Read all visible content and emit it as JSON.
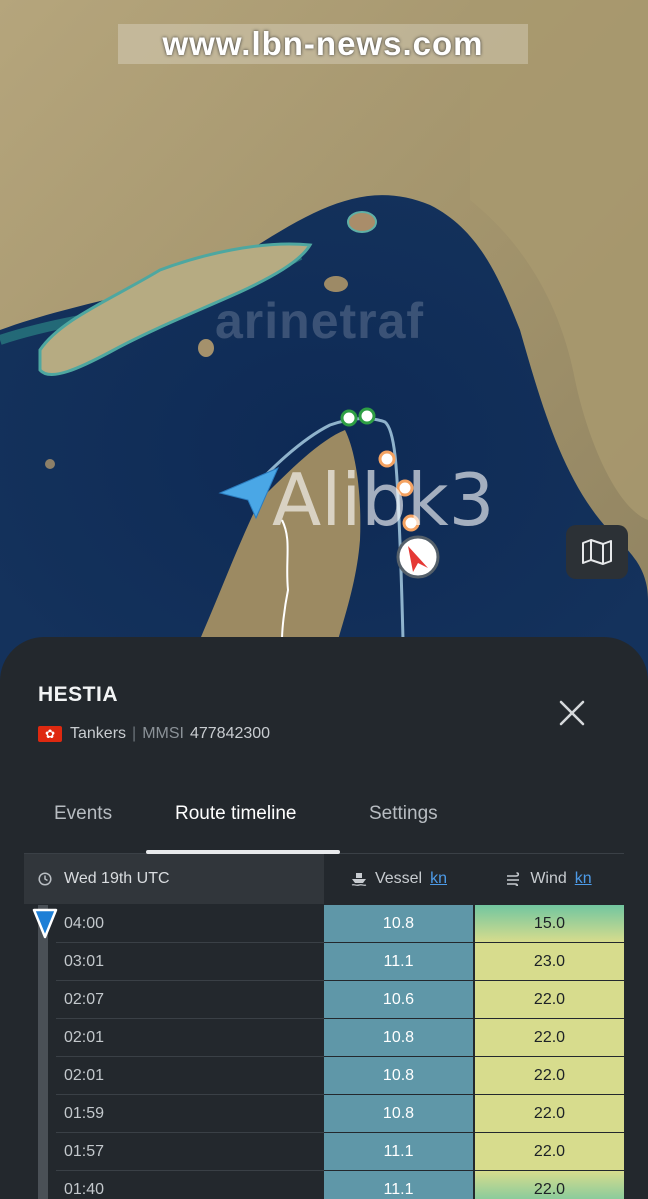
{
  "watermarks": {
    "site": "www.lbn-news.com",
    "brand": "arinetraf",
    "user": "Alibk3"
  },
  "map": {
    "layers_icon": "map-icon",
    "vessel_marker_color": "#e53935",
    "track_color": "#8fb3cc",
    "ais_gap_dot_color": "#f4a261",
    "port_dot_color": "#2e9e44"
  },
  "vessel": {
    "name": "HESTIA",
    "flag_icon": "hong-kong-flag-icon",
    "type": "Tankers",
    "separator": "|",
    "mmsi_label": "MMSI",
    "mmsi": "477842300"
  },
  "tabs": [
    {
      "label": "Events",
      "active": false
    },
    {
      "label": "Route timeline",
      "active": true
    },
    {
      "label": "Settings",
      "active": false
    }
  ],
  "table": {
    "date_header": "Wed 19th UTC",
    "vessel_header": "Vessel",
    "vessel_unit": "kn",
    "wind_header": "Wind",
    "wind_unit": "kn",
    "rows": [
      {
        "time": "04:00",
        "vessel": "10.8",
        "wind": "15.0"
      },
      {
        "time": "03:01",
        "vessel": "11.1",
        "wind": "23.0"
      },
      {
        "time": "02:07",
        "vessel": "10.6",
        "wind": "22.0"
      },
      {
        "time": "02:01",
        "vessel": "10.8",
        "wind": "22.0"
      },
      {
        "time": "02:01",
        "vessel": "10.8",
        "wind": "22.0"
      },
      {
        "time": "01:59",
        "vessel": "10.8",
        "wind": "22.0"
      },
      {
        "time": "01:57",
        "vessel": "11.1",
        "wind": "22.0"
      },
      {
        "time": "01:40",
        "vessel": "11.1",
        "wind": "22.0"
      }
    ]
  },
  "colors": {
    "panel_bg": "#23282d",
    "link": "#4d9be8",
    "vessel_cell": "#5f97a8",
    "wind_cell_low": "#72c6a0",
    "wind_cell_high": "#d7dc8d"
  }
}
